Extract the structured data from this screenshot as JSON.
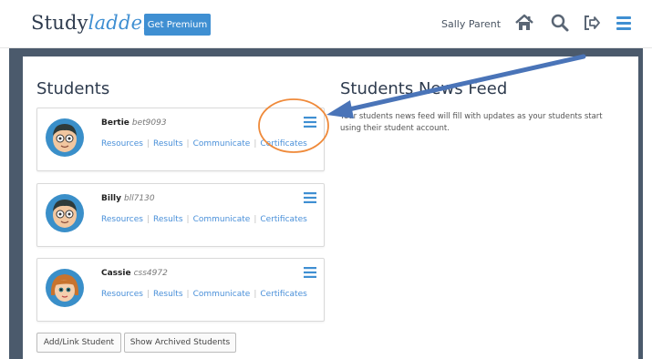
{
  "header": {
    "logo_main": "Study",
    "logo_accent": "ladder",
    "premium_label": "Get Premium",
    "user_name": "Sally Parent",
    "icons": [
      "home-icon",
      "search-icon",
      "sign-out-icon",
      "menu-icon"
    ]
  },
  "students": {
    "title": "Students",
    "list": [
      {
        "name": "Bertie",
        "id": "bet9093",
        "avatar": "boy-avatar"
      },
      {
        "name": "Billy",
        "id": "bll7130",
        "avatar": "boy-avatar"
      },
      {
        "name": "Cassie",
        "id": "css4972",
        "avatar": "girl-avatar"
      }
    ],
    "links": [
      "Resources",
      "Results",
      "Communicate",
      "Certificates"
    ],
    "add_button": "Add/Link Student",
    "archived_button": "Show Archived Students"
  },
  "news_feed": {
    "title": "Students News Feed",
    "text": "Your students news feed will fill with updates as your students start using their student account."
  },
  "colors": {
    "brand_blue": "#3f8fd2",
    "frame": "#4b5a6c",
    "annotation_orange": "#ef8a3a",
    "annotation_arrow": "#4a74b8"
  }
}
